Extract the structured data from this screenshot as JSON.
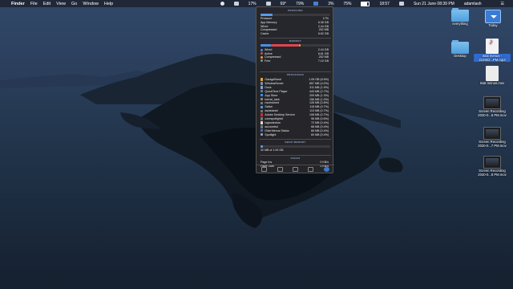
{
  "menubar": {
    "app_name": "Finder",
    "items": [
      "File",
      "Edit",
      "View",
      "Go",
      "Window",
      "Help"
    ],
    "status": {
      "cpu": "17%",
      "cpu2": "69°",
      "battery_pct": "79%",
      "mem": "3%",
      "battery2_pct": "75%",
      "network": "18:57",
      "datetime": "Sun 21 June 08:39 PM",
      "user": "adamlash"
    }
  },
  "istat": {
    "pressure_section": "PRESSURE",
    "pressure_label": "Pressure",
    "pressure_value": "17%",
    "pressure_fraction": 0.17,
    "memory_rows": [
      {
        "label": "App Memory",
        "value": "6.38 GB"
      },
      {
        "label": "Wired",
        "value": "2.44 GB"
      },
      {
        "label": "Compressed",
        "value": "252 MB"
      },
      {
        "label": "Cache",
        "value": "6.62 GB"
      }
    ],
    "memory_section": "MEMORY",
    "memory_breakdown": [
      {
        "label": "Wired",
        "value": "2.44 GB",
        "color": "#4a90e2"
      },
      {
        "label": "Active",
        "value": "6.61 GB",
        "color": "#e0454f"
      },
      {
        "label": "Compressed",
        "value": "252 MB",
        "color": "#f0a030"
      },
      {
        "label": "Free",
        "value": "7.10 GB",
        "color": "#8a8a8a"
      }
    ],
    "memory_bar": {
      "wired": 0.15,
      "active": 0.4,
      "compressed": 0.02
    },
    "processes_section": "PROCESSES",
    "processes": [
      {
        "name": "GarageBand",
        "value": "1.05 GB (6.5%)",
        "icon": "garageband-icon",
        "color": "#e8a23a"
      },
      {
        "name": "WindowServer",
        "value": "657 MB (4.0%)",
        "icon": "windowserver-icon",
        "color": "#7a8ea8"
      },
      {
        "name": "Dock",
        "value": "311 MB (1.9%)",
        "icon": "dock-icon",
        "color": "#8aa6c8"
      },
      {
        "name": "QuickTime Player",
        "value": "443 MB (2.7%)",
        "icon": "quicktime-icon",
        "color": "#5a7fb0"
      },
      {
        "name": "App Store",
        "value": "209 MB (1.3%)",
        "icon": "appstore-icon",
        "color": "#3c8ef0"
      },
      {
        "name": "kernel_task",
        "value": "156 MB (1.0%)",
        "icon": "kernel-icon",
        "color": "#888888"
      },
      {
        "name": "nsurlstored",
        "value": "126 MB (0.8%)",
        "icon": "process-icon",
        "color": "#777777"
      },
      {
        "name": "Safari",
        "value": "118 MB (0.7%)",
        "icon": "safari-icon",
        "color": "#4aa0e8"
      },
      {
        "name": "assistantd",
        "value": "113 MB (0.7%)",
        "icon": "process-icon",
        "color": "#777777"
      },
      {
        "name": "Adobe Desktop Service",
        "value": "108 MB (0.7%)",
        "icon": "adobe-icon",
        "color": "#d03030"
      },
      {
        "name": "corespotlightd",
        "value": "96 MB (0.6%)",
        "icon": "process-icon",
        "color": "#777777"
      },
      {
        "name": "loginwindow",
        "value": "72 MB (0.4%)",
        "icon": "loginwindow-icon",
        "color": "#dddddd"
      },
      {
        "name": "accountsd",
        "value": "68 MB (0.4%)",
        "icon": "process-icon",
        "color": "#777777"
      },
      {
        "name": "iStat Menus Status",
        "value": "66 MB (0.4%)",
        "icon": "istat-icon",
        "color": "#3a78d0"
      },
      {
        "name": "Spotlight",
        "value": "60 MB (0.4%)",
        "icon": "spotlight-icon",
        "color": "#9a9aa8"
      }
    ],
    "swap_section": "SWAP MEMORY",
    "swap_text": "32 MB of 1.00 GB",
    "swap_fraction": 0.03,
    "pages_section": "PAGES",
    "pages_rows": [
      {
        "label": "Page Ins",
        "value": "0 KB/s"
      },
      {
        "label": "Page Outs",
        "value": "0 KB/s"
      }
    ]
  },
  "desktop_icons": [
    {
      "name": "everything",
      "label": "everything",
      "kind": "folder",
      "label2": ""
    },
    {
      "name": "today",
      "label": "Today",
      "kind": "today",
      "label2": ""
    },
    {
      "name": "desktop",
      "label": "Desktop",
      "kind": "folder",
      "label2": ""
    },
    {
      "name": "istat-mp3",
      "label": "istat menus -",
      "kind": "music",
      "label2": "21/06/2...PM.mp3"
    },
    {
      "name": "istat-mov",
      "label": "istat menus.mov",
      "kind": "doc",
      "label2": ""
    },
    {
      "name": "screen-rec-1",
      "label": "Screen Recording",
      "kind": "mov",
      "label2": "2020-0...6 PM.mov"
    },
    {
      "name": "screen-rec-2",
      "label": "Screen Recording",
      "kind": "mov",
      "label2": "2020-0...7 PM.mov"
    },
    {
      "name": "screen-rec-3",
      "label": "Screen Recording",
      "kind": "mov",
      "label2": "2020-0...8 PM.mov"
    }
  ]
}
